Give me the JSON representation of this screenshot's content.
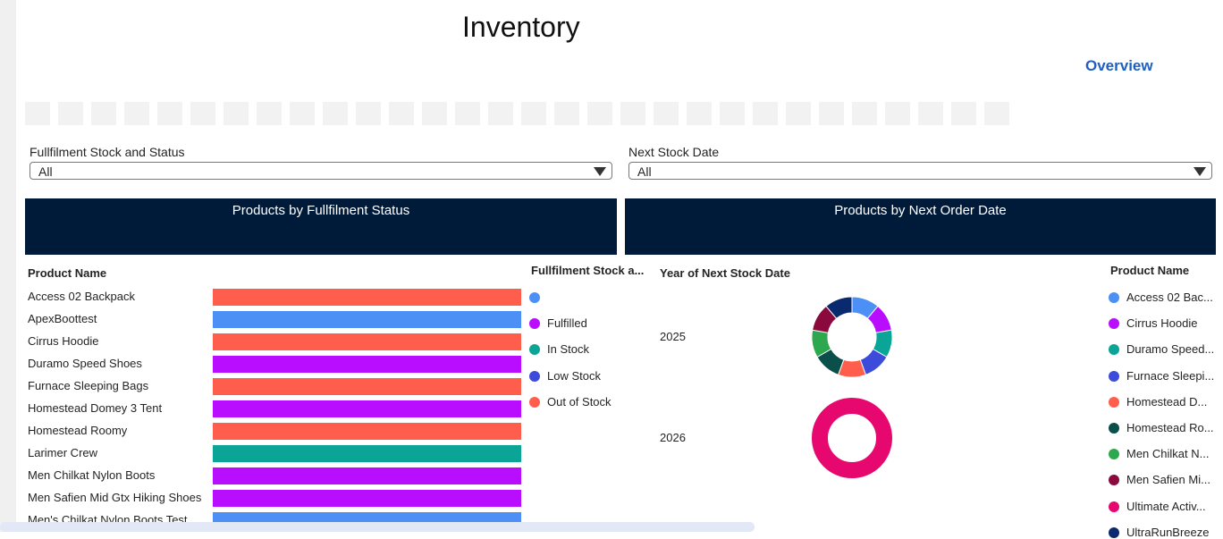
{
  "page": {
    "title": "Inventory",
    "overview_link": "Overview",
    "tile_count": 30
  },
  "filters": [
    {
      "label": "Fullfilment Stock and Status",
      "value": "All"
    },
    {
      "label": "Next Stock Date",
      "value": "All"
    }
  ],
  "panels": {
    "left_title": "Products by Fullfilment Status",
    "right_title": "Products by Next Order Date"
  },
  "bar_chart": {
    "row_header": "Product Name",
    "legend_title": "Fullfilment Stock a...",
    "status_colors": {
      "": "#4c8ff5",
      "Fulfilled": "#b80dff",
      "In Stock": "#0aa596",
      "Low Stock": "#3d4bdb",
      "Out of Stock": "#ff5e4d"
    },
    "legend": [
      "",
      "Fulfilled",
      "In Stock",
      "Low Stock",
      "Out of Stock"
    ],
    "rows": [
      {
        "product": "Access 02 Backpack",
        "status": "Out of Stock"
      },
      {
        "product": "ApexBoottest",
        "status": ""
      },
      {
        "product": "Cirrus Hoodie",
        "status": "Out of Stock"
      },
      {
        "product": "Duramo Speed Shoes",
        "status": "Fulfilled"
      },
      {
        "product": "Furnace Sleeping Bags",
        "status": "Out of Stock"
      },
      {
        "product": "Homestead Domey 3 Tent",
        "status": "Fulfilled"
      },
      {
        "product": "Homestead Roomy",
        "status": "Out of Stock"
      },
      {
        "product": "Larimer Crew",
        "status": "In Stock"
      },
      {
        "product": "Men Chilkat Nylon Boots",
        "status": "Fulfilled"
      },
      {
        "product": "Men Safien Mid Gtx Hiking Shoes",
        "status": "Fulfilled"
      },
      {
        "product": "Men's Chilkat Nylon Boots Test",
        "status": ""
      }
    ]
  },
  "donut_chart": {
    "year_header": "Year of Next Stock Date",
    "legend_title": "Product Name",
    "years": [
      {
        "year": "2025",
        "slices": [
          {
            "product": "Access 02 Bac...",
            "color": "#4c8ff5",
            "value": 1
          },
          {
            "product": "Cirrus Hoodie",
            "color": "#b80dff",
            "value": 1
          },
          {
            "product": "Duramo Speed...",
            "color": "#0aa596",
            "value": 1
          },
          {
            "product": "Furnace Sleepi...",
            "color": "#3d4bdb",
            "value": 1
          },
          {
            "product": "Homestead D...",
            "color": "#ff5e4d",
            "value": 1
          },
          {
            "product": "Homestead Ro...",
            "color": "#0a4f4a",
            "value": 1
          },
          {
            "product": "Men Chilkat N...",
            "color": "#2ea84f",
            "value": 1
          },
          {
            "product": "Men Safien Mi...",
            "color": "#8a0a3e",
            "value": 1
          },
          {
            "product": "UltraRunBreeze",
            "color": "#0a2a70",
            "value": 1
          }
        ]
      },
      {
        "year": "2026",
        "slices": [
          {
            "product": "Ultimate Activ...",
            "color": "#e6086e",
            "value": 1
          }
        ]
      }
    ],
    "legend": [
      {
        "name": "Access 02 Bac...",
        "color": "#4c8ff5"
      },
      {
        "name": "Cirrus Hoodie",
        "color": "#b80dff"
      },
      {
        "name": "Duramo Speed...",
        "color": "#0aa596"
      },
      {
        "name": "Furnace Sleepi...",
        "color": "#3d4bdb"
      },
      {
        "name": "Homestead D...",
        "color": "#ff5e4d"
      },
      {
        "name": "Homestead Ro...",
        "color": "#0a4f4a"
      },
      {
        "name": "Men Chilkat N...",
        "color": "#2ea84f"
      },
      {
        "name": "Men Safien Mi...",
        "color": "#8a0a3e"
      },
      {
        "name": "Ultimate Activ...",
        "color": "#e6086e"
      },
      {
        "name": "UltraRunBreeze",
        "color": "#0a2a70"
      }
    ]
  }
}
